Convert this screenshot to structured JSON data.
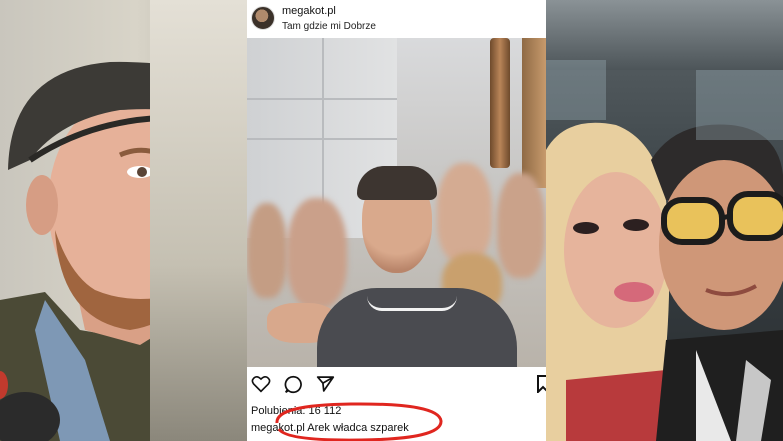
{
  "post": {
    "username": "megakot.pl",
    "location": "Tam gdzie mi Dobrze",
    "likes_text": "Polubienia: 16 112",
    "caption_user": "megakot.pl",
    "caption_text": "Arek władca szparek"
  },
  "icons": {
    "like": "heart-icon",
    "comment": "comment-icon",
    "share": "send-icon",
    "save": "bookmark-icon"
  },
  "colors": {
    "highlight_circle": "#e0261f",
    "text": "#111111"
  }
}
